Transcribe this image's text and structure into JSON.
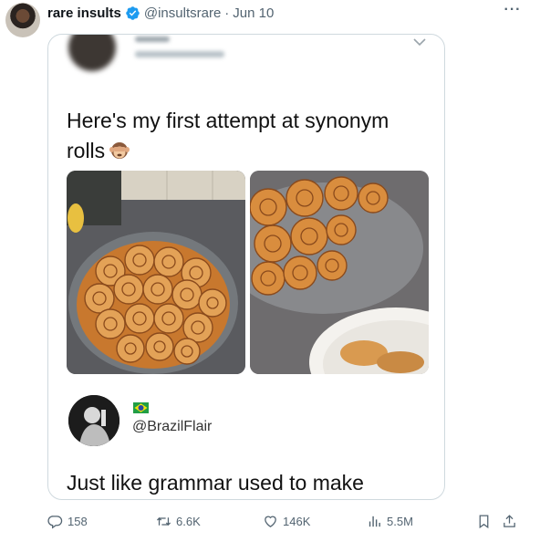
{
  "tweet": {
    "author_name": "rare insults",
    "author_handle": "@insultsrare",
    "separator": "·",
    "date": "Jun 10",
    "more_label": "···"
  },
  "embedded": {
    "text_line1": "Here's my first attempt at synonym",
    "text_line2": "rolls",
    "reply_handle": "@BrazilFlair",
    "reply_text": "Just like grammar used to make"
  },
  "actions": {
    "replies": "158",
    "retweets": "6.6K",
    "likes": "146K",
    "views": "5.5M"
  },
  "colors": {
    "verified": "#1d9bf0",
    "muted": "#536471",
    "border": "#cfd9de"
  },
  "icons": [
    "verified-badge-icon",
    "more-options-icon",
    "chevron-down-icon",
    "see-no-evil-monkey-emoji",
    "brazil-flag-icon",
    "reply-icon",
    "retweet-icon",
    "like-icon",
    "views-icon",
    "bookmark-icon",
    "share-icon"
  ]
}
